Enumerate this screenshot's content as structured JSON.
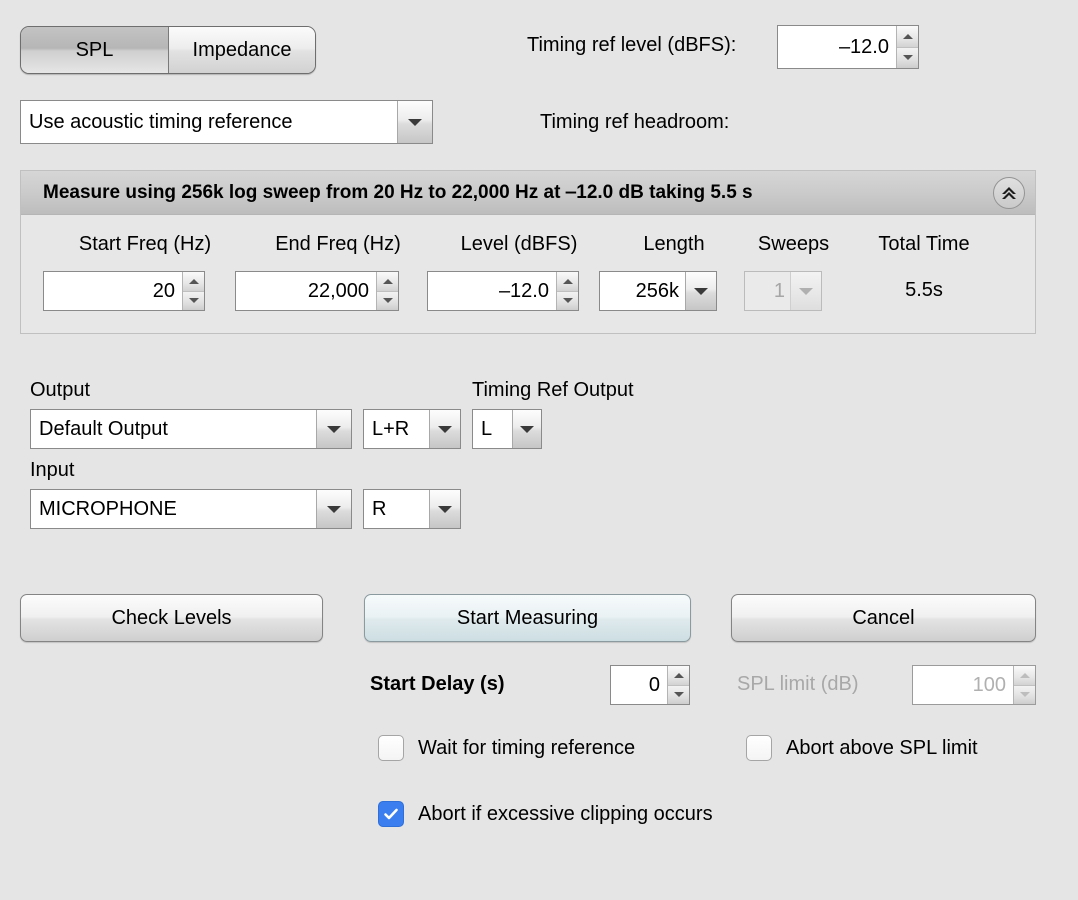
{
  "mode_tabs": {
    "selected": "SPL",
    "options": [
      "SPL",
      "Impedance"
    ]
  },
  "timing_reference": {
    "mode_value": "Use acoustic timing reference",
    "ref_level_label": "Timing ref level (dBFS):",
    "ref_level_value": "‒12.0",
    "headroom_label": "Timing ref headroom:",
    "headroom_value": ""
  },
  "measure_panel": {
    "title": "Measure using 256k log sweep from 20 Hz to 22,000 Hz at ‒12.0 dB taking 5.5 s",
    "collapse_icon": "double-chevron-up-icon",
    "fields": [
      {
        "label": "Start Freq (Hz)",
        "value": "20",
        "type": "spinner",
        "enabled": true
      },
      {
        "label": "End Freq (Hz)",
        "value": "22,000",
        "type": "spinner",
        "enabled": true
      },
      {
        "label": "Level (dBFS)",
        "value": "‒12.0",
        "type": "spinner",
        "enabled": true
      },
      {
        "label": "Length",
        "value": "256k",
        "type": "combo",
        "enabled": true
      },
      {
        "label": "Sweeps",
        "value": "1",
        "type": "combo",
        "enabled": false
      },
      {
        "label": "Total Time",
        "value": "5.5s",
        "type": "static",
        "enabled": false
      }
    ]
  },
  "routing": {
    "output_label": "Output",
    "output_device": "Default Output",
    "output_channel": "L+R",
    "timing_ref_output_label": "Timing Ref Output",
    "timing_ref_output_channel": "L",
    "input_label": "Input",
    "input_device": "MICROPHONE",
    "input_channel": "R"
  },
  "actions": {
    "check_levels": "Check Levels",
    "start_measuring": "Start Measuring",
    "cancel": "Cancel"
  },
  "options": {
    "start_delay_label": "Start Delay (s)",
    "start_delay_value": "0",
    "spl_limit_label": "SPL limit (dB)",
    "spl_limit_value": "100",
    "spl_limit_enabled": false,
    "wait_for_timing_reference": {
      "label": "Wait for timing reference",
      "checked": false
    },
    "abort_above_spl_limit": {
      "label": "Abort above SPL limit",
      "checked": false
    },
    "abort_if_excessive_clipping": {
      "label": "Abort if excessive clipping occurs",
      "checked": true
    }
  },
  "colors": {
    "background": "#e5e5e5",
    "checkbox_accent": "#3b7ef0",
    "primary_button": "#e4eef1",
    "disabled_text": "#a8a8a8"
  }
}
